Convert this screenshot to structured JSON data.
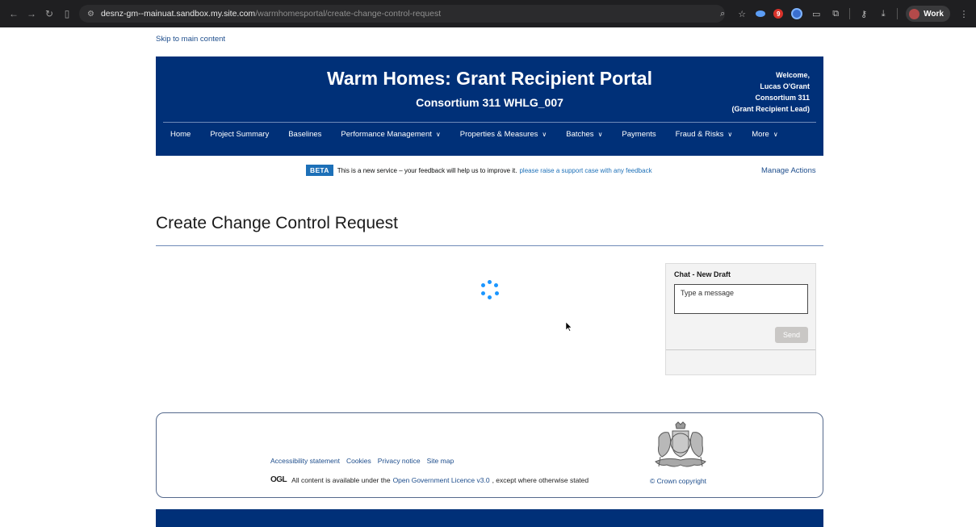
{
  "browser": {
    "url_host": "desnz-gm--mainuat.sandbox.my.site.com",
    "url_path": "/warmhomesportal/create-change-control-request",
    "profile_label": "Work",
    "extension_badge": "9",
    "icons": [
      "back-icon",
      "forward-icon",
      "reload-icon",
      "sidebar-icon",
      "site-info-icon",
      "zoom-icon",
      "star-icon",
      "extension-icon",
      "password-icon",
      "download-icon",
      "kebab-menu-icon"
    ]
  },
  "skip_link": "Skip to main content",
  "header": {
    "title": "Warm Homes: Grant Recipient Portal",
    "subtitle": "Consortium 311 WHLG_007",
    "welcome": [
      "Welcome,",
      "Lucas O'Grant",
      "Consortium 311",
      "(Grant Recipient Lead)"
    ],
    "menu": [
      {
        "label": "Home",
        "dropdown": false
      },
      {
        "label": "Project Summary",
        "dropdown": false
      },
      {
        "label": "Baselines",
        "dropdown": false
      },
      {
        "label": "Performance Management",
        "dropdown": true
      },
      {
        "label": "Properties & Measures",
        "dropdown": true
      },
      {
        "label": "Batches",
        "dropdown": true
      },
      {
        "label": "Payments",
        "dropdown": false
      },
      {
        "label": "Fraud & Risks",
        "dropdown": true
      },
      {
        "label": "More",
        "dropdown": true
      }
    ]
  },
  "beta": {
    "tag": "BETA",
    "text": "This is a new service – your feedback will help us to improve it.",
    "link": "please raise a support case with any feedback"
  },
  "manage_actions": "Manage Actions",
  "page_title": "Create Change Control Request",
  "chat": {
    "title": "Chat - New Draft",
    "placeholder": "Type a message",
    "send_label": "Send"
  },
  "footer": {
    "links": [
      "Accessibility statement",
      "Cookies",
      "Privacy notice",
      "Site map"
    ],
    "ogl_logo": "OGL",
    "licence_prefix": "All content is available under the",
    "licence_link": "Open Government Licence v3.0",
    "licence_suffix": ", except where otherwise stated",
    "copyright": "© Crown copyright"
  },
  "colors": {
    "header_bg": "#003078",
    "link": "#1d4d8c",
    "beta": "#1d70b8",
    "spinner": "#1b96ff"
  }
}
